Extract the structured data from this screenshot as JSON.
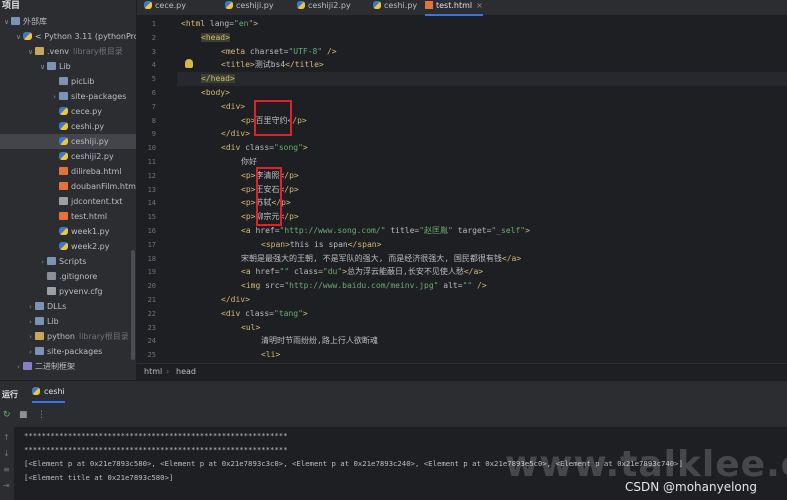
{
  "project": {
    "header": "项目",
    "tree": [
      {
        "indent": 0,
        "arrow": "∨",
        "icon": "folder",
        "label": "外部库",
        "hint": ""
      },
      {
        "indent": 1,
        "arrow": "∨",
        "icon": "py",
        "label": "< Python 3.11 (pythonProje",
        "hint": ""
      },
      {
        "indent": 2,
        "arrow": "∨",
        "icon": "folderx",
        "label": ".venv",
        "hint": "library根目录"
      },
      {
        "indent": 3,
        "arrow": "∨",
        "icon": "folder",
        "label": "Lib",
        "hint": ""
      },
      {
        "indent": 4,
        "arrow": "",
        "icon": "folder",
        "label": "picLib",
        "hint": ""
      },
      {
        "indent": 4,
        "arrow": "›",
        "icon": "folder",
        "label": "site-packages",
        "hint": ""
      },
      {
        "indent": 4,
        "arrow": "",
        "icon": "py",
        "label": "cece.py",
        "hint": ""
      },
      {
        "indent": 4,
        "arrow": "",
        "icon": "py",
        "label": "ceshi.py",
        "hint": ""
      },
      {
        "indent": 4,
        "arrow": "",
        "icon": "py",
        "label": "ceshiji.py",
        "hint": "",
        "selected": true
      },
      {
        "indent": 4,
        "arrow": "",
        "icon": "py",
        "label": "ceshiji2.py",
        "hint": ""
      },
      {
        "indent": 4,
        "arrow": "",
        "icon": "html",
        "label": "dilireba.html",
        "hint": ""
      },
      {
        "indent": 4,
        "arrow": "",
        "icon": "html",
        "label": "doubanFilm.html",
        "hint": ""
      },
      {
        "indent": 4,
        "arrow": "",
        "icon": "txt",
        "label": "jdcontent.txt",
        "hint": ""
      },
      {
        "indent": 4,
        "arrow": "",
        "icon": "html",
        "label": "test.html",
        "hint": ""
      },
      {
        "indent": 4,
        "arrow": "",
        "icon": "py",
        "label": "week1.py",
        "hint": ""
      },
      {
        "indent": 4,
        "arrow": "",
        "icon": "py",
        "label": "week2.py",
        "hint": ""
      },
      {
        "indent": 3,
        "arrow": "›",
        "icon": "folder",
        "label": "Scripts",
        "hint": ""
      },
      {
        "indent": 3,
        "arrow": "",
        "icon": "git",
        "label": ".gitignore",
        "hint": ""
      },
      {
        "indent": 3,
        "arrow": "",
        "icon": "cfg",
        "label": "pyvenv.cfg",
        "hint": ""
      },
      {
        "indent": 2,
        "arrow": "›",
        "icon": "folder",
        "label": "DLLs",
        "hint": ""
      },
      {
        "indent": 2,
        "arrow": "›",
        "icon": "folder",
        "label": "Lib",
        "hint": ""
      },
      {
        "indent": 2,
        "arrow": "›",
        "icon": "folderx",
        "label": "python",
        "hint": "library根目录"
      },
      {
        "indent": 2,
        "arrow": "›",
        "icon": "folder",
        "label": "site-packages",
        "hint": ""
      },
      {
        "indent": 1,
        "arrow": "›",
        "icon": "lib",
        "label": "二进制框架",
        "hint": ""
      }
    ]
  },
  "tabs": [
    {
      "label": "cece.py",
      "icon": "py",
      "active": false
    },
    {
      "label": "ceshiji.py",
      "icon": "py",
      "active": false
    },
    {
      "label": "ceshiji2.py",
      "icon": "py",
      "active": false
    },
    {
      "label": "ceshi.py",
      "icon": "py",
      "active": false
    },
    {
      "label": "test.html",
      "icon": "html",
      "active": true
    }
  ],
  "editor": {
    "lines": [
      {
        "n": "1",
        "indent": 0,
        "parts": [
          [
            "tg",
            "<html "
          ],
          [
            "at",
            "lang="
          ],
          [
            "vs",
            "\"en\""
          ],
          [
            "tg",
            ">"
          ]
        ]
      },
      {
        "n": "2",
        "indent": 1,
        "parts": [
          [
            "tg hl",
            "<head>"
          ]
        ]
      },
      {
        "n": "3",
        "indent": 2,
        "parts": [
          [
            "tg",
            "<meta "
          ],
          [
            "at",
            "charset="
          ],
          [
            "vs",
            "\"UTF-8\""
          ],
          [
            "tg",
            " />"
          ]
        ]
      },
      {
        "n": "4",
        "indent": 2,
        "parts": [
          [
            "tg",
            "<title>"
          ],
          [
            "",
            "测试bs4"
          ],
          [
            "tg",
            "</title>"
          ]
        ]
      },
      {
        "n": "5",
        "indent": 1,
        "parts": [
          [
            "tg hl",
            "</head>"
          ]
        ],
        "current": true
      },
      {
        "n": "6",
        "indent": 1,
        "parts": [
          [
            "tg",
            "<body>"
          ]
        ]
      },
      {
        "n": "7",
        "indent": 2,
        "parts": [
          [
            "tg",
            "<div>"
          ]
        ]
      },
      {
        "n": "8",
        "indent": 3,
        "parts": [
          [
            "tg",
            "<p>"
          ],
          [
            "",
            "百里守约"
          ],
          [
            "tg",
            "</p>"
          ]
        ]
      },
      {
        "n": "9",
        "indent": 2,
        "parts": [
          [
            "tg",
            "</div>"
          ]
        ]
      },
      {
        "n": "10",
        "indent": 2,
        "parts": [
          [
            "tg",
            "<div "
          ],
          [
            "at",
            "class="
          ],
          [
            "vs",
            "\"song\""
          ],
          [
            "tg",
            ">"
          ]
        ]
      },
      {
        "n": "11",
        "indent": 3,
        "parts": [
          [
            "",
            "你好"
          ]
        ]
      },
      {
        "n": "12",
        "indent": 3,
        "parts": [
          [
            "tg",
            "<p>"
          ],
          [
            "",
            "李清照"
          ],
          [
            "tg",
            "</p>"
          ]
        ]
      },
      {
        "n": "13",
        "indent": 3,
        "parts": [
          [
            "tg",
            "<p>"
          ],
          [
            "",
            "王安石"
          ],
          [
            "tg",
            "</p>"
          ]
        ]
      },
      {
        "n": "14",
        "indent": 3,
        "parts": [
          [
            "tg",
            "<p>"
          ],
          [
            "",
            "苏轼"
          ],
          [
            "tg",
            "</p>"
          ]
        ]
      },
      {
        "n": "15",
        "indent": 3,
        "parts": [
          [
            "tg",
            "<p>"
          ],
          [
            "",
            "柳宗元"
          ],
          [
            "tg",
            "</p>"
          ]
        ]
      },
      {
        "n": "16",
        "indent": 3,
        "parts": [
          [
            "tg",
            "<a "
          ],
          [
            "at",
            "href="
          ],
          [
            "vs",
            "\"http://www.song.com/\""
          ],
          [
            "at",
            " title="
          ],
          [
            "vs",
            "\"赵匡胤\""
          ],
          [
            "at",
            " target="
          ],
          [
            "vs",
            "\"_self\""
          ],
          [
            "tg",
            ">"
          ]
        ]
      },
      {
        "n": "17",
        "indent": 4,
        "parts": [
          [
            "tg",
            "<span>"
          ],
          [
            "",
            "this is span"
          ],
          [
            "tg",
            "</span>"
          ]
        ]
      },
      {
        "n": "18",
        "indent": 3,
        "parts": [
          [
            "",
            "宋朝是最强大的王朝, 不是军队的强大, 而是经济很强大, 国民都很有钱"
          ],
          [
            "tg",
            "</a>"
          ]
        ]
      },
      {
        "n": "19",
        "indent": 3,
        "parts": [
          [
            "tg",
            "<a "
          ],
          [
            "at",
            "href="
          ],
          [
            "vs",
            "\"\""
          ],
          [
            "at",
            " class="
          ],
          [
            "vs",
            "\"du\""
          ],
          [
            "tg",
            ">"
          ],
          [
            "",
            "总为浮云能蔽日,长安不见使人愁"
          ],
          [
            "tg",
            "</a>"
          ]
        ]
      },
      {
        "n": "20",
        "indent": 3,
        "parts": [
          [
            "tg",
            "<img "
          ],
          [
            "at",
            "src="
          ],
          [
            "vs",
            "\"http://www.baidu.com/meinv.jpg\""
          ],
          [
            "at",
            " alt="
          ],
          [
            "vs",
            "\"\""
          ],
          [
            "tg",
            " />"
          ]
        ]
      },
      {
        "n": "21",
        "indent": 2,
        "parts": [
          [
            "tg",
            "</div>"
          ]
        ]
      },
      {
        "n": "22",
        "indent": 2,
        "parts": [
          [
            "tg",
            "<div "
          ],
          [
            "at",
            "class="
          ],
          [
            "vs",
            "\"tang\""
          ],
          [
            "tg",
            ">"
          ]
        ]
      },
      {
        "n": "23",
        "indent": 3,
        "parts": [
          [
            "tg",
            "<ul>"
          ]
        ]
      },
      {
        "n": "24",
        "indent": 4,
        "parts": [
          [
            "",
            "清明时节雨纷纷,路上行人欲断魂"
          ]
        ]
      },
      {
        "n": "25",
        "indent": 4,
        "parts": [
          [
            "tg",
            "<li>"
          ]
        ]
      }
    ]
  },
  "breadcrumbs": [
    "html",
    "head"
  ],
  "run": {
    "label": "运行",
    "tab": "ceshi",
    "console": [
      "************************************************************",
      "************************************************************",
      "[<Element p at 0x21e7893c580>, <Element p at 0x21e7893c3c0>, <Element p at 0x21e7893c240>, <Element p at 0x21e7893e5c0>, <Element p at 0x21e7893c740>]",
      "[<Element title at 0x21e7893c580>]"
    ]
  },
  "watermark": "www.talklee.com",
  "csdn": "CSDN @mohanyelong",
  "colors": {
    "accent": "#3574f0",
    "redbox": "#e0212a",
    "tag": "#d5b778",
    "string": "#6aab73"
  }
}
